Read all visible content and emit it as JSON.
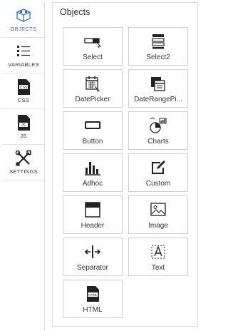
{
  "sidebar": {
    "items": [
      {
        "label": "OBJECTS",
        "icon": "cubes-icon",
        "active": true
      },
      {
        "label": "VARIABLES",
        "icon": "list-icon",
        "active": false
      },
      {
        "label": "CSS",
        "icon": "css-file-icon",
        "active": false
      },
      {
        "label": "JS",
        "icon": "js-file-icon",
        "active": false
      },
      {
        "label": "SETTINGS",
        "icon": "tools-icon",
        "active": false
      }
    ]
  },
  "panel": {
    "title": "Objects",
    "objects": [
      {
        "label": "Select",
        "icon": "select-icon"
      },
      {
        "label": "Select2",
        "icon": "select2-icon"
      },
      {
        "label": "DatePicker",
        "icon": "calendar-icon"
      },
      {
        "label": "DateRangePi...",
        "icon": "calendar-range-icon"
      },
      {
        "label": "Button",
        "icon": "button-icon"
      },
      {
        "label": "Charts",
        "icon": "charts-icon"
      },
      {
        "label": "Adhoc",
        "icon": "bar-chart-icon"
      },
      {
        "label": "Custom",
        "icon": "custom-edit-icon"
      },
      {
        "label": "Header",
        "icon": "header-icon"
      },
      {
        "label": "Image",
        "icon": "image-icon"
      },
      {
        "label": "Separator",
        "icon": "separator-icon"
      },
      {
        "label": "Text",
        "icon": "text-icon"
      },
      {
        "label": "HTML",
        "icon": "html-file-icon"
      }
    ]
  },
  "colors": {
    "accent": "#2f6fd0",
    "border": "#dcdcdc",
    "icon": "#222222"
  }
}
